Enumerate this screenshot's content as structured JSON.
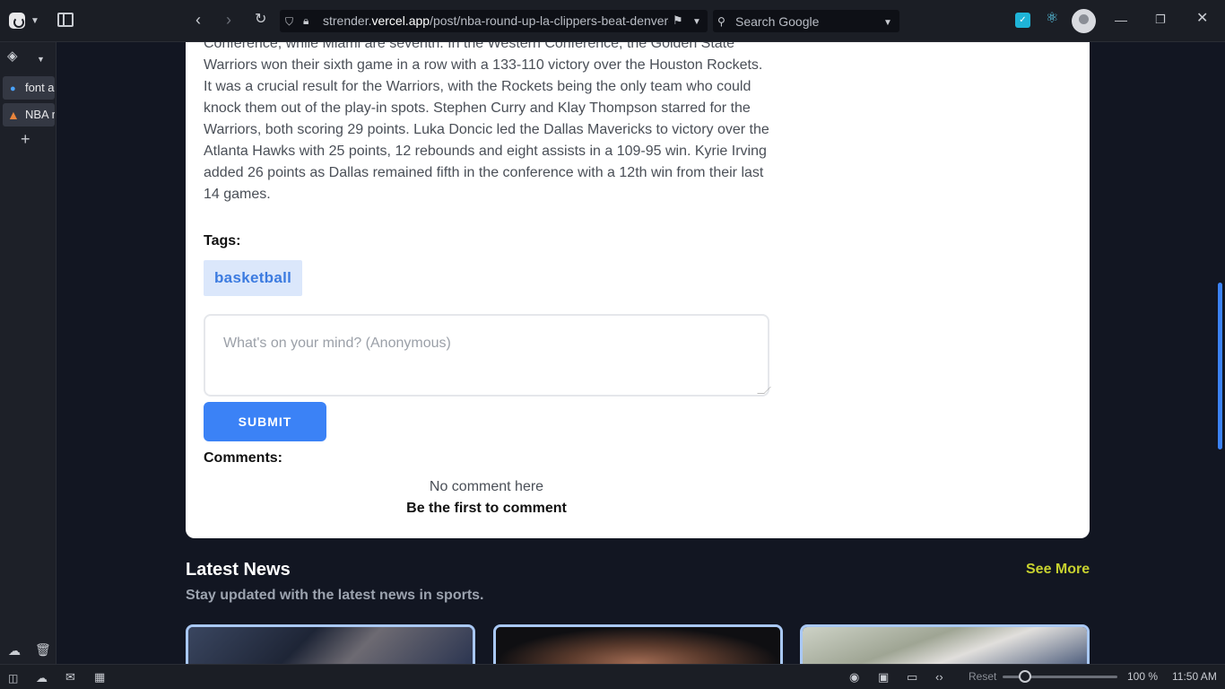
{
  "browser": {
    "url_domain": "strender.",
    "url_domain_bold": "vercel.app",
    "url_path": "/post/nba-round-up-la-clippers-beat-denver-nu",
    "search_placeholder": "Search Google"
  },
  "side_panel": {
    "tabs": [
      {
        "label": "font a"
      },
      {
        "label": "NBA r"
      }
    ]
  },
  "article": {
    "body": "Conference, while Miami are seventh. In the Western Conference, the Golden State Warriors won their sixth game in a row with a 133-110 victory over the Houston Rockets. It was a crucial result for the Warriors, with the Rockets being the only team who could knock them out of the play-in spots. Stephen Curry and Klay Thompson starred for the Warriors, both scoring 29 points. Luka Doncic led the Dallas Mavericks to victory over the Atlanta Hawks with 25 points, 12 rebounds and eight assists in a 109-95 win. Kyrie Irving added 26 points as Dallas remained fifth in the conference with a 12th win from their last 14 games.",
    "tags_label": "Tags:",
    "tags": [
      "basketball"
    ]
  },
  "comment_form": {
    "placeholder": "What's on your mind? (Anonymous)",
    "submit_label": "SUBMIT"
  },
  "comments": {
    "label": "Comments:",
    "empty_text": "No comment here",
    "empty_cta": "Be the first to comment"
  },
  "latest_news": {
    "title": "Latest News",
    "see_more": "See More",
    "subtitle": "Stay updated with the latest news in sports."
  },
  "status_bar": {
    "reset_label": "Reset",
    "zoom": "100 %",
    "time": "11:50 AM"
  },
  "colors": {
    "accent": "#3b82f6",
    "see_more": "#c7d12f",
    "tag_bg": "#dbe7fb"
  }
}
